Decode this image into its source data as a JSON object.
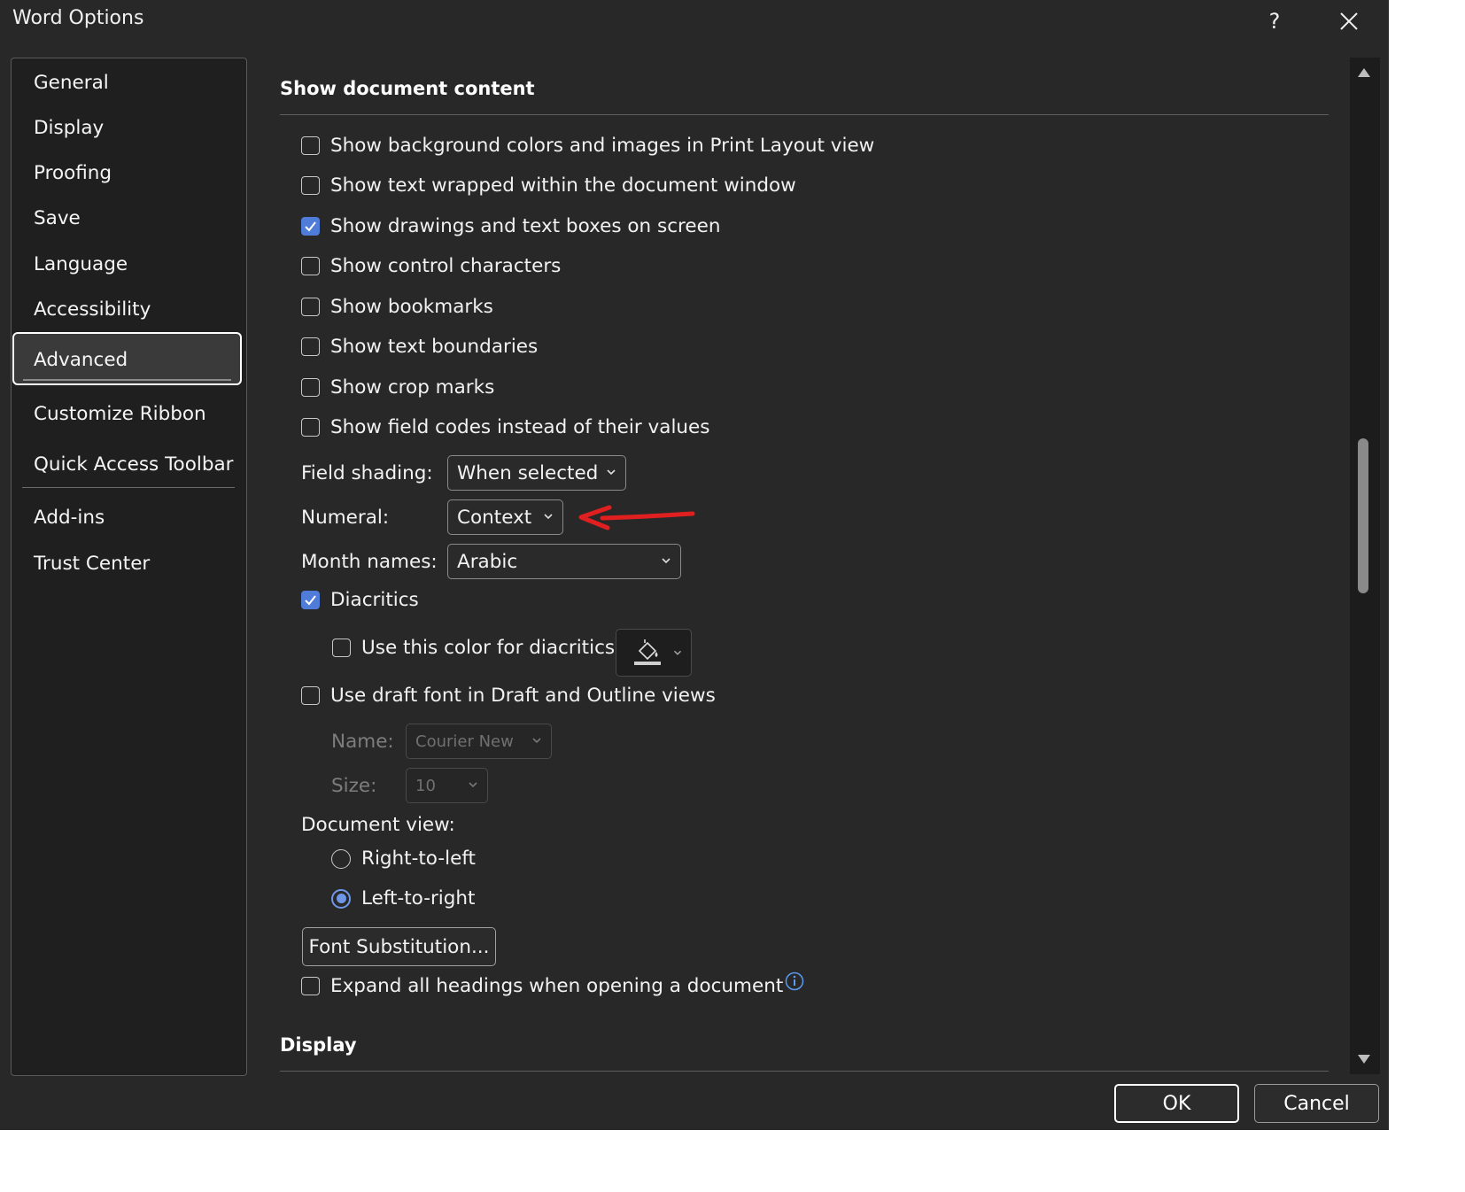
{
  "window": {
    "title": "Word Options",
    "help_label": "?"
  },
  "sidebar": {
    "items": [
      {
        "label": "General"
      },
      {
        "label": "Display"
      },
      {
        "label": "Proofing"
      },
      {
        "label": "Save"
      },
      {
        "label": "Language"
      },
      {
        "label": "Accessibility"
      },
      {
        "label": "Advanced",
        "selected": true
      },
      {
        "label": "Customize Ribbon"
      },
      {
        "label": "Quick Access Toolbar"
      },
      {
        "label": "Add-ins"
      },
      {
        "label": "Trust Center"
      }
    ]
  },
  "show_document_content": {
    "title": "Show document content",
    "checkboxes": [
      {
        "label": "Show background colors and images in Print Layout view",
        "checked": false
      },
      {
        "label": "Show text wrapped within the document window",
        "checked": false
      },
      {
        "label": "Show drawings and text boxes on screen",
        "checked": true
      },
      {
        "label": "Show control characters",
        "checked": false
      },
      {
        "label": "Show bookmarks",
        "checked": false
      },
      {
        "label": "Show text boundaries",
        "checked": false
      },
      {
        "label": "Show crop marks",
        "checked": false
      },
      {
        "label": "Show field codes instead of their values",
        "checked": false
      }
    ],
    "field_shading": {
      "label": "Field shading:",
      "value": "When selected"
    },
    "numeral": {
      "label": "Numeral:",
      "value": "Context"
    },
    "month_names": {
      "label": "Month names:",
      "value": "Arabic"
    },
    "diacritics": {
      "label": "Diacritics",
      "checked": true
    },
    "diacritics_color": {
      "label": "Use this color for diacritics",
      "checked": false
    },
    "draft_font": {
      "label": "Use draft font in Draft and Outline views",
      "checked": false
    },
    "draft_name": {
      "label": "Name:",
      "value": "Courier New"
    },
    "draft_size": {
      "label": "Size:",
      "value": "10"
    },
    "document_view": {
      "label": "Document view:",
      "options": [
        {
          "label": "Right-to-left",
          "selected": false
        },
        {
          "label": "Left-to-right",
          "selected": true
        }
      ]
    },
    "font_substitution_button": "Font Substitution...",
    "expand_headings": {
      "label": "Expand all headings when opening a document",
      "checked": false
    }
  },
  "display_section": {
    "title": "Display"
  },
  "footer": {
    "ok_label": "OK",
    "cancel_label": "Cancel"
  },
  "colors": {
    "accent": "#4f7bd9",
    "annotation_arrow": "#e02020"
  }
}
